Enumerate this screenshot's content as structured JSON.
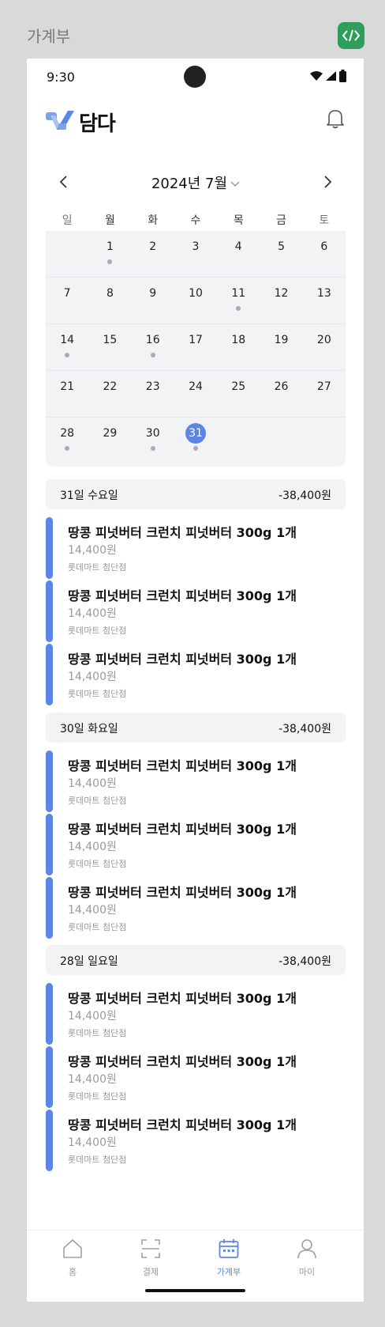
{
  "frame": {
    "title": "가계부",
    "code_icon": "code-icon"
  },
  "status_bar": {
    "time": "9:30"
  },
  "app": {
    "logo_text": "담다",
    "bell_icon": "bell-icon"
  },
  "calendar": {
    "month_label": "2024년 7월",
    "weekdays": [
      "일",
      "월",
      "화",
      "수",
      "목",
      "금",
      "토"
    ],
    "weeks": [
      [
        {
          "d": ""
        },
        {
          "d": "1",
          "dot": true
        },
        {
          "d": "2"
        },
        {
          "d": "3"
        },
        {
          "d": "4"
        },
        {
          "d": "5"
        },
        {
          "d": "6"
        }
      ],
      [
        {
          "d": "7"
        },
        {
          "d": "8"
        },
        {
          "d": "9"
        },
        {
          "d": "10"
        },
        {
          "d": "11",
          "dot": true
        },
        {
          "d": "12"
        },
        {
          "d": "13"
        }
      ],
      [
        {
          "d": "14",
          "dot": true
        },
        {
          "d": "15"
        },
        {
          "d": "16",
          "dot": true
        },
        {
          "d": "17"
        },
        {
          "d": "18"
        },
        {
          "d": "19"
        },
        {
          "d": "20"
        }
      ],
      [
        {
          "d": "21"
        },
        {
          "d": "22"
        },
        {
          "d": "23"
        },
        {
          "d": "24"
        },
        {
          "d": "25"
        },
        {
          "d": "26"
        },
        {
          "d": "27"
        }
      ],
      [
        {
          "d": "28",
          "dot": true
        },
        {
          "d": "29"
        },
        {
          "d": "30",
          "dot": true
        },
        {
          "d": "31",
          "dot": true,
          "selected": true
        },
        {
          "d": ""
        },
        {
          "d": ""
        },
        {
          "d": ""
        }
      ]
    ],
    "accent_color": "#5b86e5"
  },
  "groups": [
    {
      "date": "31일 수요일",
      "total": "-38,400원",
      "items": [
        {
          "title": "땅콩 피넛버터 크런치 피넛버터 300g 1개",
          "amount": "14,400원",
          "store": "롯데마트 첨단점"
        },
        {
          "title": "땅콩 피넛버터 크런치 피넛버터 300g 1개",
          "amount": "14,400원",
          "store": "롯데마트 첨단점"
        },
        {
          "title": "땅콩 피넛버터 크런치 피넛버터 300g 1개",
          "amount": "14,400원",
          "store": "롯데마트 첨단점"
        }
      ]
    },
    {
      "date": "30일 화요일",
      "total": "-38,400원",
      "items": [
        {
          "title": "땅콩 피넛버터 크런치 피넛버터 300g 1개",
          "amount": "14,400원",
          "store": "롯데마트 첨단점"
        },
        {
          "title": "땅콩 피넛버터 크런치 피넛버터 300g 1개",
          "amount": "14,400원",
          "store": "롯데마트 첨단점"
        },
        {
          "title": "땅콩 피넛버터 크런치 피넛버터 300g 1개",
          "amount": "14,400원",
          "store": "롯데마트 첨단점"
        }
      ]
    },
    {
      "date": "28일 일요일",
      "total": "-38,400원",
      "items": [
        {
          "title": "땅콩 피넛버터 크런치 피넛버터 300g 1개",
          "amount": "14,400원",
          "store": "롯데마트 첨단점"
        },
        {
          "title": "땅콩 피넛버터 크런치 피넛버터 300g 1개",
          "amount": "14,400원",
          "store": "롯데마트 첨단점"
        },
        {
          "title": "땅콩 피넛버터 크런치 피넛버터 300g 1개",
          "amount": "14,400원",
          "store": "롯데마트 첨단점"
        }
      ]
    }
  ],
  "tabbar": {
    "tabs": [
      {
        "label": "홈",
        "icon": "home-icon"
      },
      {
        "label": "결제",
        "icon": "scan-icon"
      },
      {
        "label": "가계부",
        "icon": "calendar-icon",
        "active": true
      },
      {
        "label": "마이",
        "icon": "person-icon"
      }
    ]
  }
}
